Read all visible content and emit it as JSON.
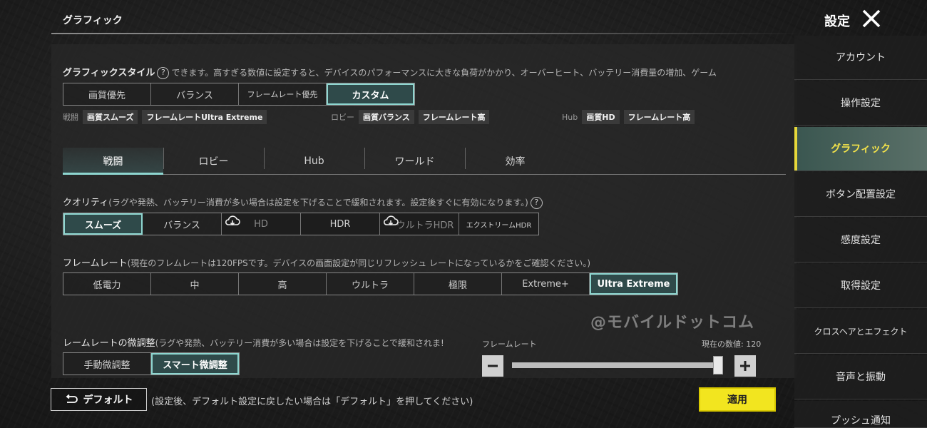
{
  "header": {
    "page_title": "グラフィック",
    "settings_title": "設定"
  },
  "graphics_style": {
    "label": "グラフィックスタイル",
    "description": "できます。高すぎる数値に設定すると、デバイスのパフォーマンスに大きな負荷がかかり、オーバーヒート、バッテリー消費量の増加、ゲーム",
    "options": [
      "画質優先",
      "バランス",
      "フレームレート優先",
      "カスタム"
    ],
    "selected": "カスタム"
  },
  "summary": [
    {
      "label": "戦闘",
      "chips": [
        "画質スムーズ",
        "フレームレートUltra Extreme"
      ]
    },
    {
      "label": "ロビー",
      "chips": [
        "画質バランス",
        "フレームレート高"
      ]
    },
    {
      "label": "Hub",
      "chips": [
        "画質HD",
        "フレームレート高"
      ]
    }
  ],
  "tabs": [
    {
      "label": "戦闘",
      "active": true
    },
    {
      "label": "ロビー",
      "active": false
    },
    {
      "label": "Hub",
      "active": false
    },
    {
      "label": "ワールド",
      "active": false
    },
    {
      "label": "効率",
      "active": false
    }
  ],
  "quality": {
    "label": "クオリティ",
    "note": "(ラグや発熱、バッテリー消費が多い場合は設定を下げることで緩和されます。設定後すぐに有効になります。)",
    "options": [
      "スムーズ",
      "バランス",
      "HD",
      "HDR",
      "ウルトラHDR",
      "エクストリームHDR"
    ],
    "selected": "スムーズ",
    "download_icon_on": [
      "HD",
      "ウルトラHDR"
    ]
  },
  "framerate": {
    "label": "フレームレート",
    "note": "(現在のフレムレートは120FPSです。デバイスの画面設定が同じリフレッシュ レートになっているかをご確認ください。)",
    "options": [
      "低電力",
      "中",
      "高",
      "ウルトラ",
      "極限",
      "Extreme+",
      "Ultra Extreme"
    ],
    "selected": "Ultra Extreme"
  },
  "fine_tune": {
    "label": "レームレートの微調整",
    "note": "(ラグや発熱、バッテリー消費が多い場合は設定を下げることで緩和されま!",
    "options": [
      "手動微調整",
      "スマート微調整"
    ],
    "selected": "スマート微調整",
    "slider_label": "フレームレート",
    "current_value_label": "現在の数値: 120",
    "slider_level": 1.0
  },
  "watermark": "@モバイルドットコム",
  "footer": {
    "default_label": "デフォルト",
    "note": "(設定後、デフォルト設定に戻したい場合は「デフォルト」を押してください)",
    "apply_label": "適用"
  },
  "sidebar": {
    "items": [
      "アカウント",
      "操作設定",
      "グラフィック",
      "ボタン配置設定",
      "感度設定",
      "取得設定",
      "クロスヘアとエフェクト",
      "音声と振動",
      "プッシュ通知"
    ],
    "active": "グラフィック"
  },
  "colors": {
    "accent_teal": "#8ed6d0",
    "apply_yellow": "#f2e51f",
    "sidebar_active_text": "#f5e44a"
  }
}
